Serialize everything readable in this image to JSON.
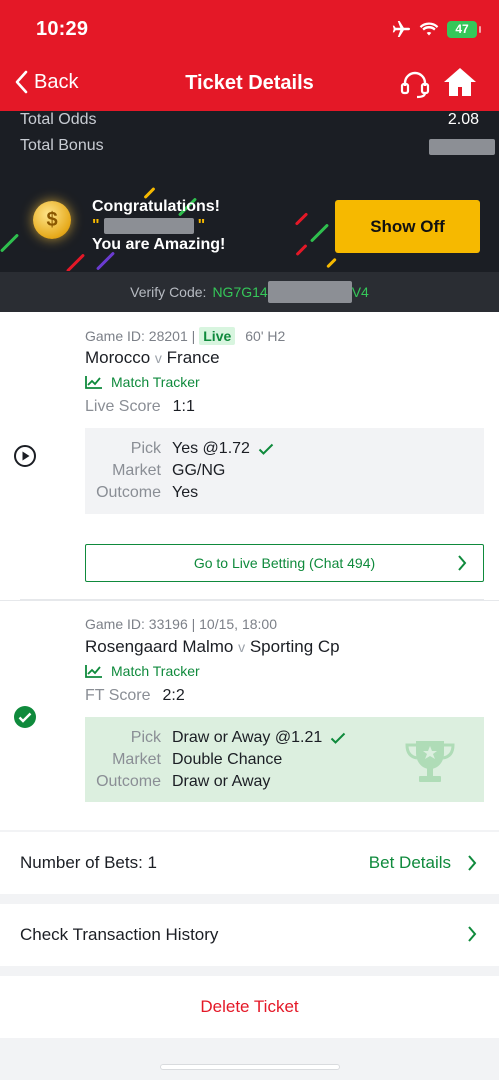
{
  "status": {
    "time": "10:29",
    "battery": "47"
  },
  "nav": {
    "back_label": "Back",
    "title": "Ticket Details"
  },
  "summary": {
    "total_odds_label": "Total Odds",
    "total_odds_value": "2.08",
    "total_bonus_label": "Total Bonus",
    "congrats_line1": "Congratulations!",
    "congrats_quote_open": "\"",
    "congrats_quote_close": "\"",
    "congrats_line3": "You are Amazing!",
    "show_off_label": "Show Off",
    "verify_label": "Verify Code:",
    "verify_code_start": "NG7G14",
    "verify_code_end": "V4"
  },
  "bets": [
    {
      "game_id": "Game ID: 28201 |",
      "live_tag": "Live",
      "time_info": "60' H2",
      "home": "Morocco",
      "vs": "v",
      "away": "France",
      "tracker_label": "Match Tracker",
      "score_label": "Live Score",
      "score": "1:1",
      "pick_label": "Pick",
      "pick_value": "Yes @1.72",
      "market_label": "Market",
      "market_value": "GG/NG",
      "outcome_label": "Outcome",
      "outcome_value": "Yes",
      "live_button": "Go to Live Betting (Chat 494)"
    },
    {
      "game_id": "Game ID: 33196 | 10/15, 18:00",
      "home": "Rosengaard Malmo",
      "vs": "v",
      "away": "Sporting Cp",
      "tracker_label": "Match Tracker",
      "score_label": "FT Score",
      "score": "2:2",
      "pick_label": "Pick",
      "pick_value": "Draw or Away @1.21",
      "market_label": "Market",
      "market_value": "Double Chance",
      "outcome_label": "Outcome",
      "outcome_value": "Draw or Away"
    }
  ],
  "footer": {
    "num_bets": "Number of Bets: 1",
    "bet_details": "Bet Details",
    "history": "Check Transaction History",
    "delete": "Delete Ticket"
  },
  "colors": {
    "brand_red": "#e41827",
    "accent_green": "#0f8a3c",
    "gold": "#f6b900"
  }
}
